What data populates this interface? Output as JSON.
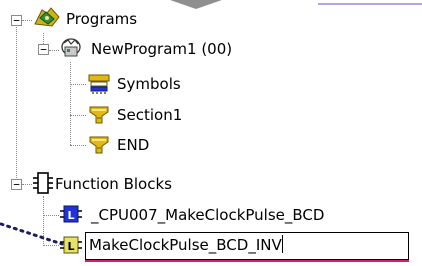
{
  "tree": {
    "programs": {
      "label": "Programs",
      "expander": "−",
      "icon": "programs-folder-icon"
    },
    "new_program": {
      "label": "NewProgram1 (00)",
      "expander": "−",
      "icon": "program-task-icon"
    },
    "symbols": {
      "label": "Symbols",
      "icon": "symbols-table-icon"
    },
    "section1": {
      "label": "Section1",
      "icon": "ladder-section-icon"
    },
    "end": {
      "label": "END",
      "icon": "ladder-section-icon"
    },
    "function_blocks": {
      "label": "Function Blocks",
      "expander": "−",
      "icon": "function-blocks-icon"
    },
    "fb1": {
      "label": "_CPU007_MakeClockPulse_BCD",
      "icon": "fb-library-icon"
    },
    "fb2": {
      "label": "MakeClockPulse_BCD_INV",
      "icon": "fb-ladder-icon",
      "editing": true
    }
  },
  "colors": {
    "accent_blue": "#1f33d6",
    "fb_yellow": "#e8e26a",
    "section_gold": "#e3b812",
    "underline_pink": "#d81a7a"
  }
}
